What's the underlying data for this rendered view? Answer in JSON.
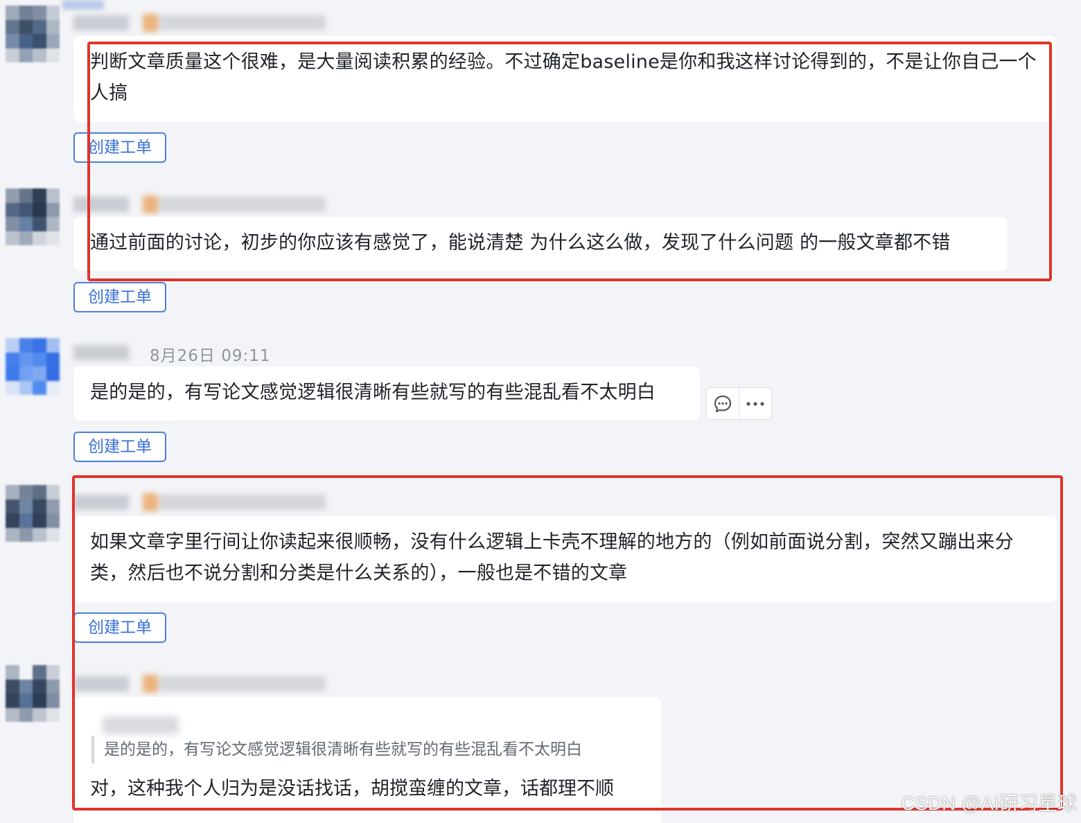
{
  "messages": [
    {
      "text": "判断文章质量这个很难，是大量阅读积累的经验。不过确定baseline是你和我这样讨论得到的，不是让你自己一个人搞",
      "ticket_label": "创建工单"
    },
    {
      "text": "通过前面的讨论，初步的你应该有感觉了，能说清楚 为什么这么做，发现了什么问题 的一般文章都不错",
      "ticket_label": "创建工单"
    },
    {
      "timestamp": "8月26日 09:11",
      "text": "是的是的，有写论文感觉逻辑很清晰有些就写的有些混乱看不太明白",
      "ticket_label": "创建工单"
    },
    {
      "text": "如果文章字里行间让你读起来很顺畅，没有什么逻辑上卡壳不理解的地方的（例如前面说分割，突然又蹦出来分类，然后也不说分割和分类是什么关系的），一般也是不错的文章",
      "ticket_label": "创建工单"
    },
    {
      "quote": "是的是的，有写论文感觉逻辑很清晰有些就写的有些混乱看不太明白",
      "text": "对，这种我个人归为是没话找话，胡搅蛮缠的文章，话都理不顺"
    }
  ],
  "icons": {
    "reply": "comment-bubble-icon",
    "more": "more-dots-icon"
  },
  "colors": {
    "background": "#f3f4f7",
    "highlight": "#e0342b",
    "button": "#3a6fd8"
  },
  "watermark": "CSDN @AI研习星球"
}
